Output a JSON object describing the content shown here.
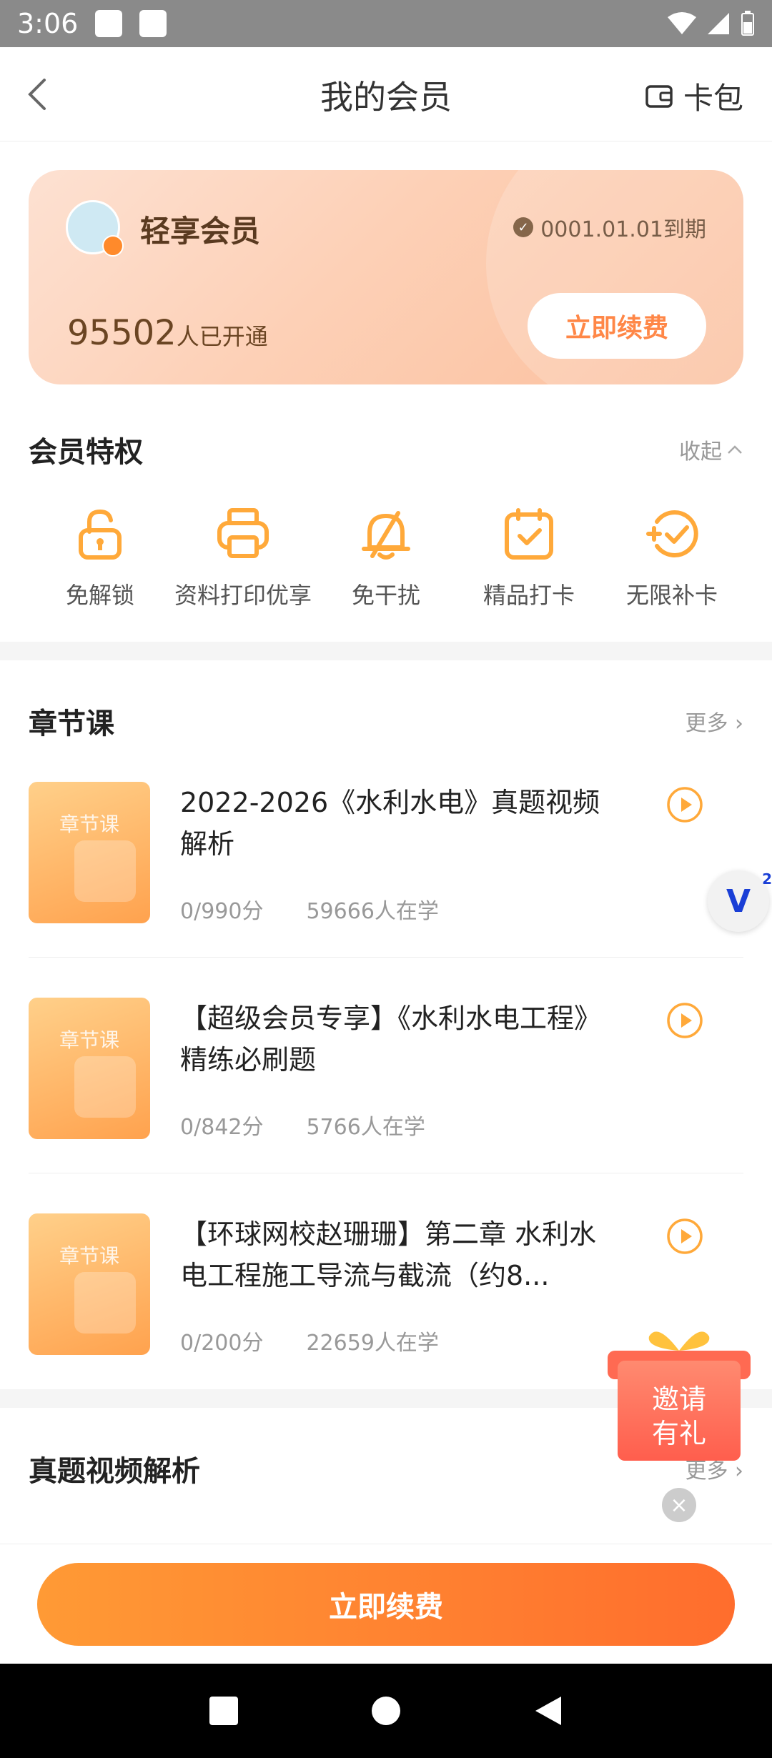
{
  "status_bar": {
    "time": "3:06"
  },
  "header": {
    "title": "我的会员",
    "wallet_label": "卡包"
  },
  "member_card": {
    "title": "轻享会员",
    "expire_text": "0001.01.01到期",
    "member_count": "95502",
    "member_count_suffix": "人已开通",
    "renew_label": "立即续费"
  },
  "privileges": {
    "title": "会员特权",
    "collapse_label": "收起",
    "items": [
      {
        "label": "免解锁",
        "icon": "unlock-icon"
      },
      {
        "label": "资料打印优享",
        "icon": "printer-icon"
      },
      {
        "label": "免干扰",
        "icon": "bell-off-icon"
      },
      {
        "label": "精品打卡",
        "icon": "calendar-check-icon"
      },
      {
        "label": "无限补卡",
        "icon": "refill-check-icon"
      }
    ]
  },
  "chapter_courses": {
    "title": "章节课",
    "more_label": "更多",
    "thumb_tag": "章节课",
    "items": [
      {
        "title": "2022-2026《水利水电》真题视频解析",
        "score": "0/990分",
        "learners": "59666人在学"
      },
      {
        "title": "【超级会员专享】《水利水电工程》精练必刷题",
        "score": "0/842分",
        "learners": "5766人在学"
      },
      {
        "title": "【环球网校赵珊珊】第二章 水利水电工程施工导流与截流（约8...",
        "score": "0/200分",
        "learners": "22659人在学"
      }
    ]
  },
  "real_exam": {
    "title": "真题视频解析",
    "more_label": "更多"
  },
  "floating": {
    "v_label": "V",
    "v_badge": "2",
    "invite_label_1": "邀请",
    "invite_label_2": "有礼"
  },
  "bottom": {
    "renew_label": "立即续费"
  },
  "colors": {
    "accent": "#ff7a2b",
    "icon": "#ffa93a"
  }
}
